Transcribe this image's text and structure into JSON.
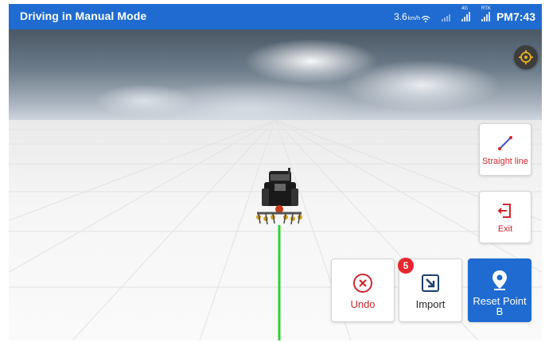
{
  "status_bar": {
    "title": "Driving in Manual Mode",
    "speed": "3.6",
    "speed_unit": "km/h",
    "sat_label": "4G",
    "rtk_label": "RTK",
    "time": "PM7:43",
    "color": "#1f6bd1"
  },
  "map": {
    "locate_icon": "crosshair-icon",
    "guidance_line_color": "#2fd02f"
  },
  "controls": {
    "straight_line_label": "Straight line",
    "exit_label": "Exit",
    "undo_label": "Undo",
    "import_label": "Import",
    "import_badge": "5",
    "reset_label": "Reset Point B"
  },
  "colors": {
    "accent": "#1f6bd1",
    "danger": "#d0262d",
    "badge": "#e8262e"
  }
}
